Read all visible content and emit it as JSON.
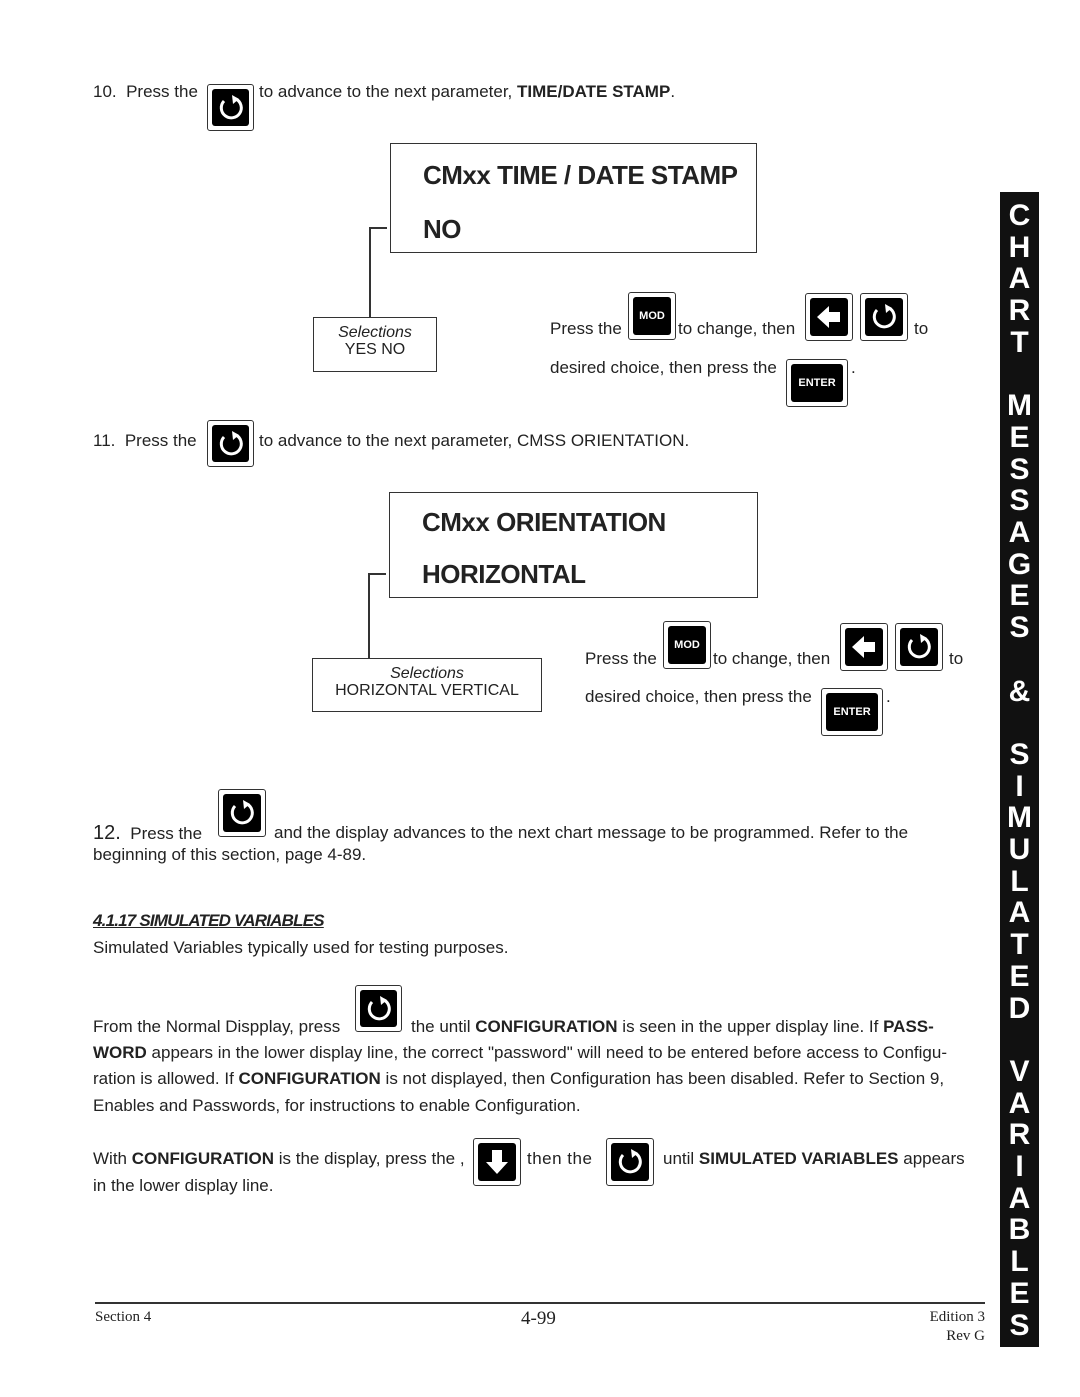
{
  "step10": {
    "num": "10.",
    "pre": "Press the",
    "post": "to advance to the next parameter, ",
    "bold": "TIME/DATE STAMP",
    "end": "."
  },
  "display1": {
    "line1": "CMxx  TIME / DATE  STAMP",
    "line2": "NO"
  },
  "selections1": {
    "title": "Selections",
    "options": "YES    NO"
  },
  "instr": {
    "press": "Press the",
    "change": "to change, then",
    "to": "to",
    "desired": "desired choice, then press the",
    "period": "."
  },
  "keys": {
    "mod": "MOD",
    "enter": "ENTER"
  },
  "step11": {
    "num": "11.",
    "pre": "Press the",
    "post": "to advance to the next parameter, CMSS ORIENTATION."
  },
  "display2": {
    "line1": "CMxx  ORIENTATION",
    "line2": "HORIZONTAL"
  },
  "selections2": {
    "title": "Selections",
    "options": "HORIZONTAL     VERTICAL"
  },
  "step12": {
    "num": "12.",
    "pre": "Press the",
    "post": "and the display advances to the next chart message to be programmed.  Refer to the",
    "line2": "beginning of this section, page 4-89."
  },
  "section": {
    "heading": "4.1.17  SIMULATED VARIABLES",
    "intro": "Simulated Variables typically used for testing purposes."
  },
  "para1": {
    "a": "From the Normal Dispplay, press",
    "b": "the until ",
    "c": "CONFIGURATION",
    "d": " is seen in the upper display line.  If ",
    "e": "PASS-",
    "l2a": "WORD",
    "l2b": " appears in the lower display line, the correct \"password\" will need to be entered before access to Configu-",
    "l3a": "ration is allowed.  If ",
    "l3b": "CONFIGURATION",
    "l3c": " is not displayed, then Configuration has been disabled.  Refer to Section 9,",
    "l4": "Enables and Passwords, for instructions to enable Configuration."
  },
  "para2": {
    "a": "With ",
    "b": "CONFIGURATION",
    "c": " is the display, press the ,",
    "d": "then  the",
    "e": "until ",
    "f": "SIMULATED VARIABLES",
    "g": " appears",
    "l2": "in the lower display line."
  },
  "footer": {
    "left": "Section 4",
    "center": "4-99",
    "right1": "Edition 3",
    "right2": "Rev G"
  },
  "side_tab": "CHART MESSAGES & SIMULATED VARIABLES"
}
